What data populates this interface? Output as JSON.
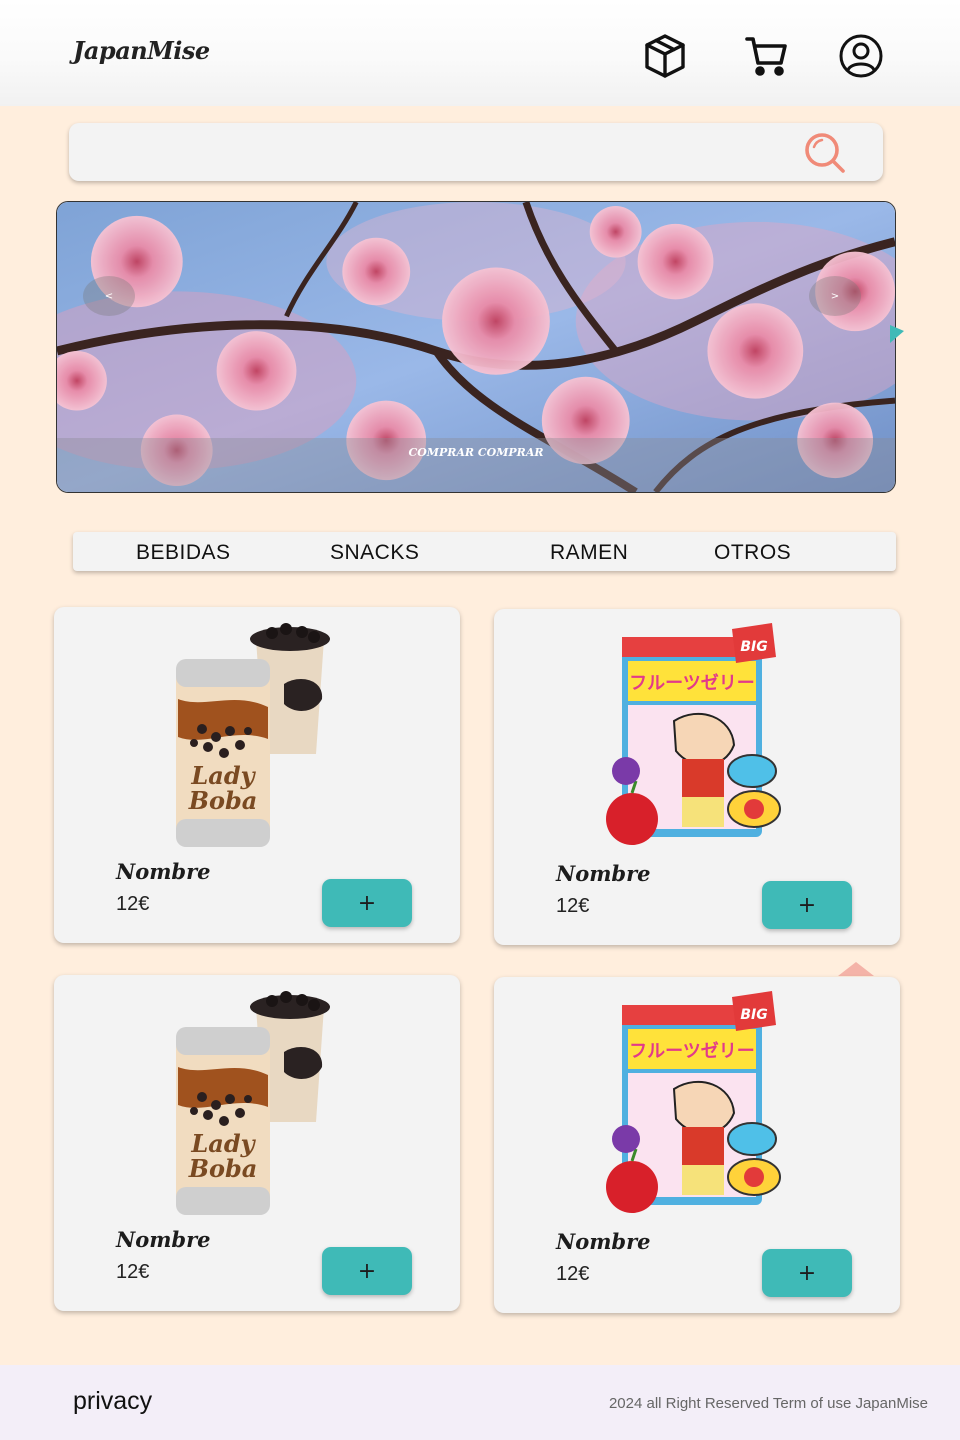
{
  "header": {
    "logo": "JapanMise",
    "icons": [
      "package-icon",
      "cart-icon",
      "user-icon"
    ]
  },
  "search": {
    "value": "",
    "placeholder": "",
    "icon": "search-icon",
    "icon_color": "#f08a78"
  },
  "banner": {
    "caption": "COMPRAR COMPRAR",
    "prev_label": "<",
    "next_label": ">"
  },
  "categories": [
    "BEBIDAS",
    "SNACKS",
    "RAMEN",
    "OTROS"
  ],
  "products": [
    {
      "name": "Nombre",
      "price": "12€",
      "add_label": "+",
      "image": "bubble-tea-can-image"
    },
    {
      "name": "Nombre",
      "price": "12€",
      "add_label": "+",
      "image": "fruit-jelly-bag-image"
    },
    {
      "name": "Nombre",
      "price": "12€",
      "add_label": "+",
      "image": "bubble-tea-can-image"
    },
    {
      "name": "Nombre",
      "price": "12€",
      "add_label": "+",
      "image": "fruit-jelly-bag-image"
    }
  ],
  "footer": {
    "privacy": "privacy",
    "copyright": "2024 all Right Reserved Term of use JapanMise"
  },
  "colors": {
    "page_background": "#ffeedd",
    "accent_button": "#3fbab7",
    "footer_background": "#f3eef8"
  }
}
